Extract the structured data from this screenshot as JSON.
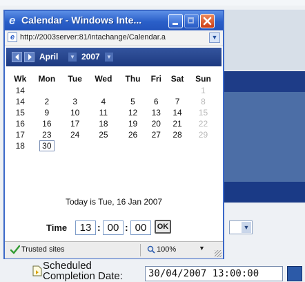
{
  "background": {
    "scheduled_label_line1": "Scheduled",
    "scheduled_label_line2": "Completion Date:",
    "scheduled_value": "30/04/2007 13:00:00"
  },
  "window": {
    "title": "Calendar - Windows Inte...",
    "address_url": "http://2003server:81/intachange/Calendar.a"
  },
  "calendar": {
    "month": "April",
    "year": "2007",
    "headers": [
      "Wk",
      "Mon",
      "Tue",
      "Wed",
      "Thu",
      "Fri",
      "Sat",
      "Sun"
    ],
    "rows": [
      [
        "14",
        "",
        "",
        "",
        "",
        "",
        "",
        "1"
      ],
      [
        "14",
        "2",
        "3",
        "4",
        "5",
        "6",
        "7",
        "8"
      ],
      [
        "15",
        "9",
        "10",
        "11",
        "12",
        "13",
        "14",
        "15"
      ],
      [
        "16",
        "16",
        "17",
        "18",
        "19",
        "20",
        "21",
        "22"
      ],
      [
        "17",
        "23",
        "24",
        "25",
        "26",
        "27",
        "28",
        "29"
      ],
      [
        "18",
        "30",
        "",
        "",
        "",
        "",
        "",
        ""
      ]
    ],
    "selected_day": "30",
    "today_text": "Today is Tue, 16 Jan 2007"
  },
  "time": {
    "label": "Time",
    "hour": "13",
    "minute": "00",
    "second": "00",
    "ok_label": "OK"
  },
  "status": {
    "trusted_text": "Trusted sites",
    "zoom_text": "100%"
  },
  "colors": {
    "titlebar": "#2a5fc8",
    "calendar_header": "#1d3a80",
    "close_button": "#cc3d14"
  }
}
